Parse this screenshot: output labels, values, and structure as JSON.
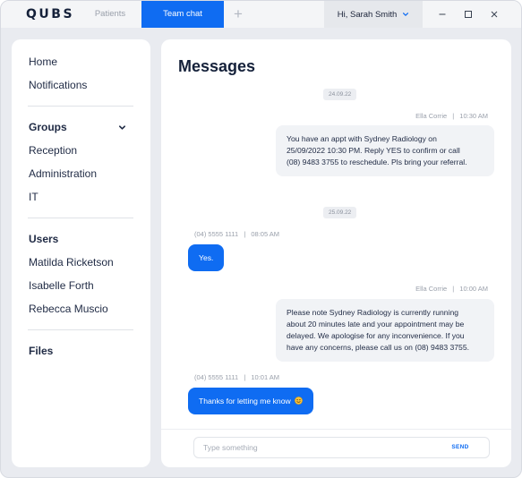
{
  "app": {
    "logo": "QUBS"
  },
  "tabs": [
    {
      "label": "Patients",
      "active": false
    },
    {
      "label": "Team chat",
      "active": true
    }
  ],
  "header": {
    "user_greeting": "Hi, Sarah Smith"
  },
  "sidebar": {
    "home": "Home",
    "notifications": "Notifications",
    "groups_header": "Groups",
    "groups": [
      "Reception",
      "Administration",
      "IT"
    ],
    "users_header": "Users",
    "users": [
      "Matilda Ricketson",
      "Isabelle Forth",
      "Rebecca Muscio"
    ],
    "files_header": "Files"
  },
  "main": {
    "title": "Messages",
    "dates": [
      "24.09.22",
      "25.09.22"
    ],
    "messages": [
      {
        "direction": "incoming",
        "sender": "Ella Corrie",
        "time": "10:30 AM",
        "lines": [
          "You have an appt with  Sydney Radiology on",
          "25/09/2022 10:30 PM. Reply YES to confirm or call",
          "(08) 9483 3755  to reschedule. Pls bring your referral."
        ]
      },
      {
        "direction": "outgoing",
        "sender": "(04) 5555 1111",
        "time": "08:05 AM",
        "text": "Yes."
      },
      {
        "direction": "incoming",
        "sender": "Ella Corrie",
        "time": "10:00 AM",
        "lines": [
          "Please note Sydney Radiology is currently running",
          "about 20 minutes late and your appointment may be",
          "delayed. We apologise for any inconvenience. If you",
          "have any concerns, please call us on (08) 9483 3755."
        ]
      },
      {
        "direction": "outgoing",
        "sender": "(04) 5555 1111",
        "time": "10:01 AM",
        "text": "Thanks for letting me know"
      }
    ],
    "meta_separator": "|"
  },
  "composer": {
    "placeholder": "Type something",
    "send_label": "SEND"
  },
  "colors": {
    "accent": "#0f6cf2",
    "bubble_incoming": "#f1f3f6",
    "background": "#e9ebf0"
  },
  "icons": {
    "add_tab": "plus-icon",
    "user_menu": "chevron-down-icon",
    "groups_toggle": "chevron-down-icon",
    "window": [
      "minimize-icon",
      "maximize-icon",
      "close-icon"
    ],
    "emoji": "smiley-emoji-icon"
  }
}
